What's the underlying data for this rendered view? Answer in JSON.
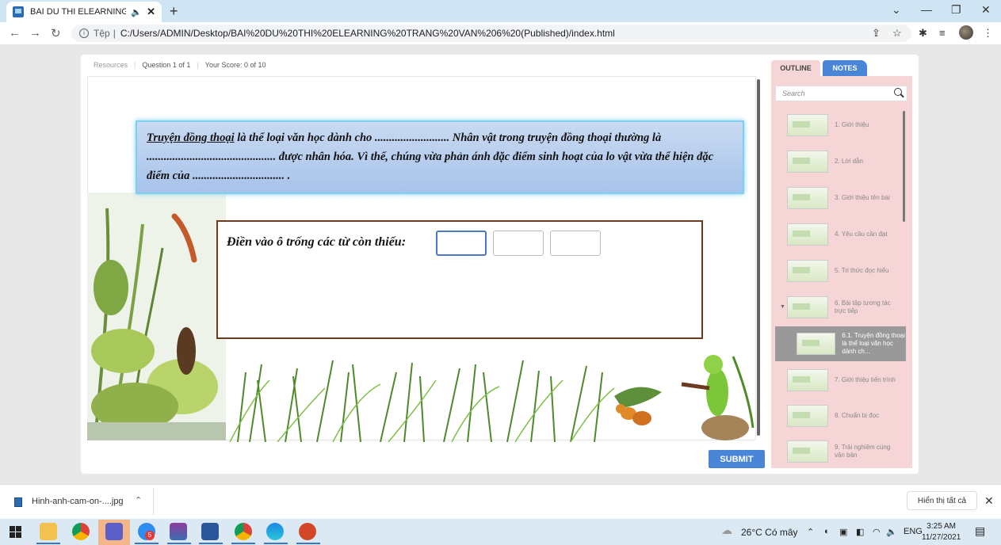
{
  "browser": {
    "tab_title": "BAI DU THI ELEARNING TRA",
    "speaker_icon": "speaker-icon",
    "new_tab": "+",
    "address_protocol": "Tệp",
    "address_sep": "|",
    "address_url": "C:/Users/ADMIN/Desktop/BAI%20DU%20THI%20ELEARNING%20TRANG%20VAN%206%20(Published)/index.html"
  },
  "player": {
    "resources": "Resources",
    "question": "Question 1 of 1",
    "score": "Your Score: 0 of 10",
    "passage_underlined": "Truyện đồng thoại",
    "passage_rest": " là thể loại văn học dành cho .......................... Nhân vật trong truyện đồng thoại thường là ............................................. được nhân hóa. Vì thế, chúng vừa phản ánh đặc điểm sinh hoạt của lo vật vừa thể hiện đặc điểm của ................................                    .",
    "question_label": "Điền vào ô trống các từ còn thiếu:",
    "submit": "SUBMIT"
  },
  "sidebar": {
    "tab_outline": "OUTLINE",
    "tab_notes": "NOTES",
    "search_placeholder": "Search",
    "items": [
      {
        "label": "1. Giới thiệu"
      },
      {
        "label": "2. Lời dẫn"
      },
      {
        "label": "3. Giới thiệu tên bài"
      },
      {
        "label": "4. Yêu cầu cần đạt"
      },
      {
        "label": "5. Tri thức đọc hiểu"
      },
      {
        "label": "6. Bài tập tương tác trực tiếp"
      },
      {
        "label": "6.1. Truyện đồng thoại là thể loại văn học dành ch..."
      },
      {
        "label": "7. Giới thiệu tiến trình"
      },
      {
        "label": "8. Chuẩn bị đọc"
      },
      {
        "label": "9. Trải nghiệm cùng văn bản"
      }
    ]
  },
  "download": {
    "filename": "Hinh-anh-cam-on-....jpg",
    "show_all": "Hiển thị tất cả"
  },
  "taskbar": {
    "weather": "26°C  Có mây",
    "lang": "ENG",
    "time": "3:25 AM",
    "date": "11/27/2021",
    "badge": "5"
  }
}
